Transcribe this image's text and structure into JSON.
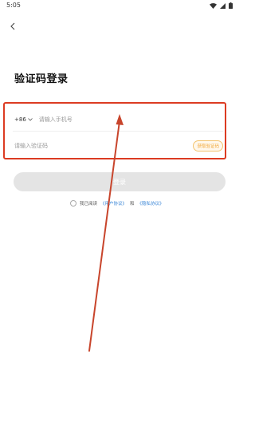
{
  "status_bar": {
    "time": "5:05",
    "icons": [
      "wifi-icon",
      "cellular-signal-icon",
      "battery-icon"
    ]
  },
  "nav": {
    "back_icon": "chevron-left-icon"
  },
  "page": {
    "title": "验证码登录"
  },
  "form": {
    "country_code": "+86",
    "country_code_icon": "chevron-down-icon",
    "phone_placeholder": "请输入手机号",
    "phone_value": "",
    "code_placeholder": "请输入验证码",
    "code_value": "",
    "get_code_label": "获取验证码"
  },
  "login": {
    "label": "登录"
  },
  "agreement": {
    "prefix": "我已阅读",
    "user_agreement": "《用户协议》",
    "connector": "和",
    "privacy_policy": "《隐私协议》"
  },
  "colors": {
    "annotation_red": "#dc3b22",
    "accent_orange": "#f0a431",
    "link_blue": "#3a86d6",
    "disabled_button": "#e4e4e4"
  }
}
